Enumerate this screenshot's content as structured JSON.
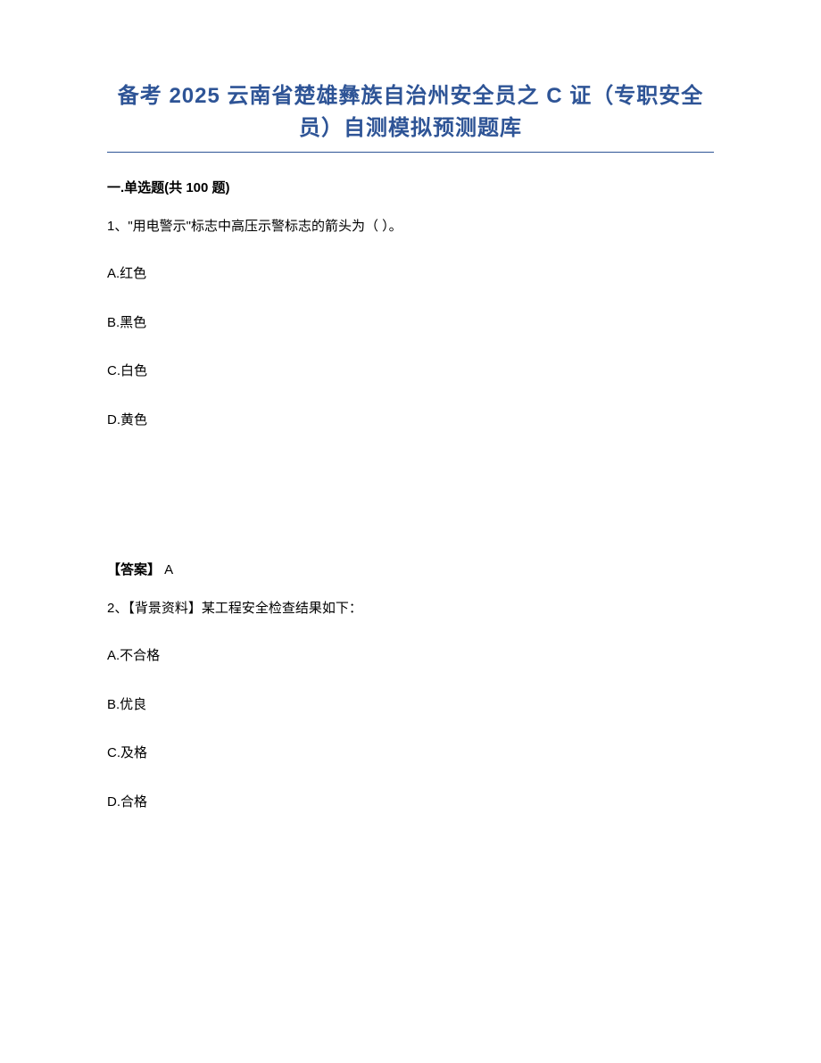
{
  "title_line1": "备考 2025 云南省楚雄彝族自治州安全员之 C 证（专职安全",
  "title_line2": "员）自测模拟预测题库",
  "section_header": "一.单选题(共 100 题)",
  "q1": {
    "text": "1、\"用电警示\"标志中高压示警标志的箭头为（ ）。",
    "options": {
      "a": "A.红色",
      "b": "B.黑色",
      "c": "C.白色",
      "d": "D.黄色"
    },
    "answer_label": "【答案】",
    "answer_value": " A"
  },
  "q2": {
    "text": "2、【背景资料】某工程安全检查结果如下：",
    "options": {
      "a": "A.不合格",
      "b": "B.优良",
      "c": "C.及格",
      "d": "D.合格"
    }
  }
}
